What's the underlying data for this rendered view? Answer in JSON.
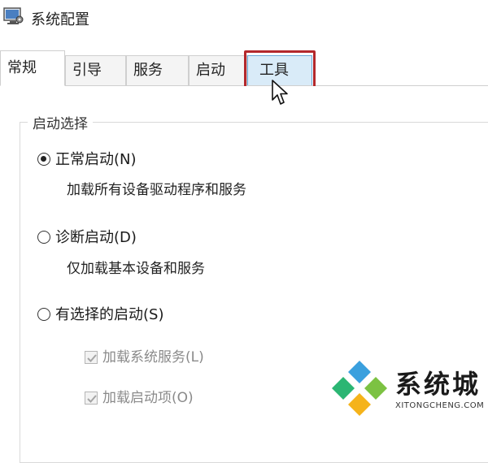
{
  "window": {
    "title": "系统配置",
    "icon": "msconfig-icon"
  },
  "tabs": [
    {
      "label": "常规",
      "state": "selected"
    },
    {
      "label": "引导",
      "state": "normal"
    },
    {
      "label": "服务",
      "state": "normal"
    },
    {
      "label": "启动",
      "state": "normal"
    },
    {
      "label": "工具",
      "state": "hover-highlighted"
    }
  ],
  "startup_group": {
    "caption": "启动选择",
    "options": [
      {
        "label": "正常启动(N)",
        "description": "加载所有设备驱动程序和服务",
        "checked": true
      },
      {
        "label": "诊断启动(D)",
        "description": "仅加载基本设备和服务",
        "checked": false
      },
      {
        "label": "有选择的启动(S)",
        "checked": false
      }
    ],
    "sub_options": [
      {
        "label": "加载系统服务(L)",
        "checked": true,
        "disabled": true
      },
      {
        "label": "加载启动项(O)",
        "checked": true,
        "disabled": true
      }
    ]
  },
  "annotation": {
    "highlight_color": "#b3282c"
  },
  "watermark": {
    "name": "系统城",
    "url": "XITONGCHENG.COM"
  }
}
